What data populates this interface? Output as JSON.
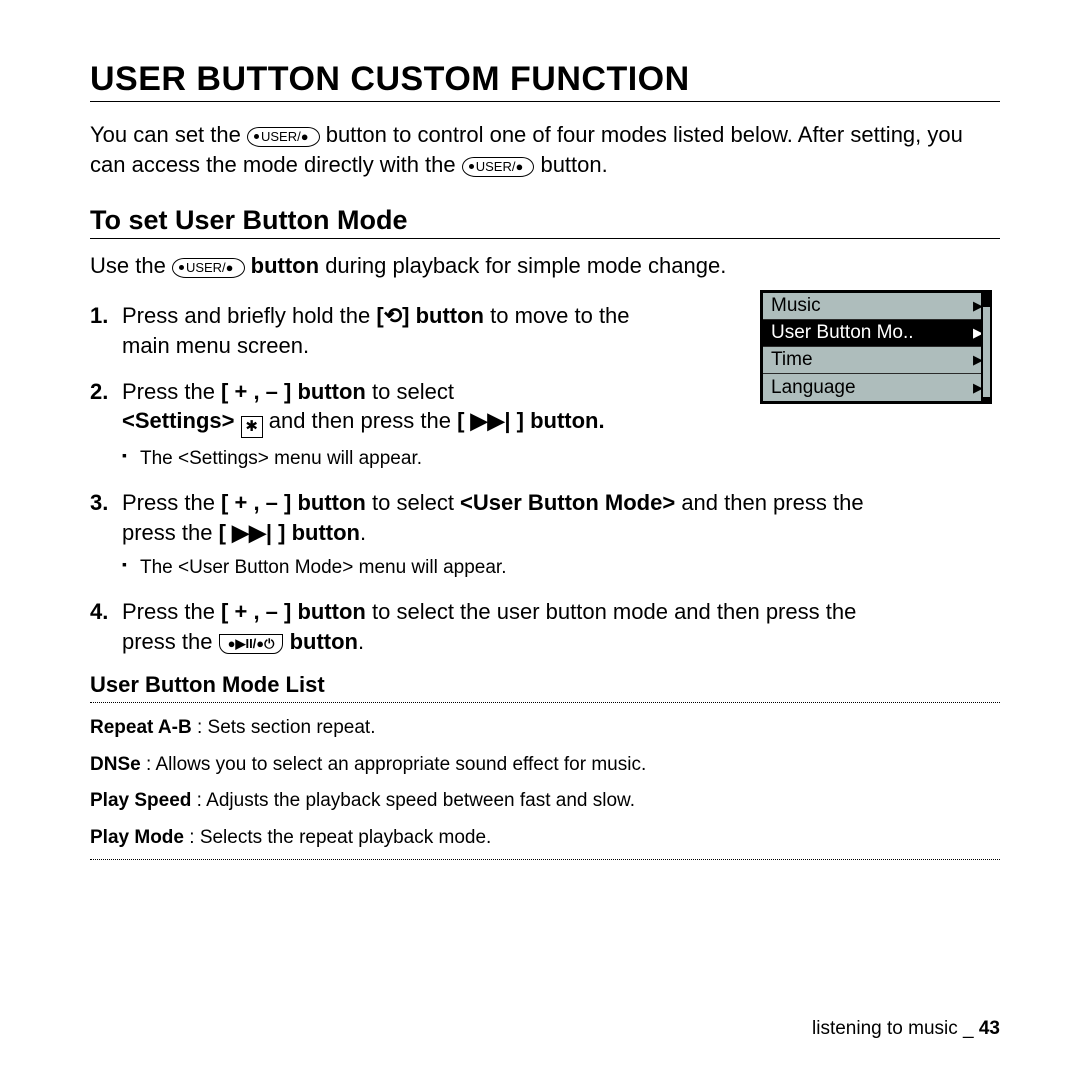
{
  "title": "USER BUTTON CUSTOM FUNCTION",
  "intro": {
    "a": "You can set the ",
    "b": " button to control one of four modes listed below. After setting, you can access the mode directly with the ",
    "c": " button."
  },
  "subTitle": "To set User Button Mode",
  "useLine": {
    "a": "Use the ",
    "b": " button",
    "c": " during playback for simple mode change."
  },
  "pill": {
    "dotUserRec": "USER/",
    "recGlyph": "●",
    "playPause": "●▶II/●",
    "power": "⏻"
  },
  "steps": {
    "s1a": "Press and briefly hold the ",
    "s1btn": "[⟲] button",
    "s1b": " to move to the main menu screen.",
    "s2a": "Press the ",
    "s2btn": "[ + , – ] button",
    "s2b": " to select ",
    "s2c": "<Settings>",
    "s2d": " and then press the ",
    "s2e": "[ ▶▶| ] button.",
    "s2note": "The <Settings> menu will appear.",
    "s3a": "Press the ",
    "s3b": " to select ",
    "s3c": "<User Button Mode>",
    "s3d": " and then press the ",
    "s3e": "[ ▶▶| ] button",
    "s3f": ".",
    "s3note": "The <User Button Mode> menu will appear.",
    "s4a": "Press the ",
    "s4b": " to select the user button mode and then press the ",
    "s4c": " button",
    "s4d": "."
  },
  "screenMenu": [
    "Music",
    "User Button Mo..",
    "Time",
    "Language"
  ],
  "screenSelectedIndex": 1,
  "listTitle": "User Button Mode List",
  "modes": [
    {
      "name": "Repeat A-B",
      "desc": " : Sets section repeat."
    },
    {
      "name": "DNSe",
      "desc": " : Allows you to select an appropriate sound effect for music."
    },
    {
      "name": "Play Speed",
      "desc": " : Adjusts the playback speed between fast and slow."
    },
    {
      "name": "Play Mode",
      "desc": " : Selects the repeat playback mode."
    }
  ],
  "footer": {
    "section": "listening to music _ ",
    "page": "43"
  }
}
